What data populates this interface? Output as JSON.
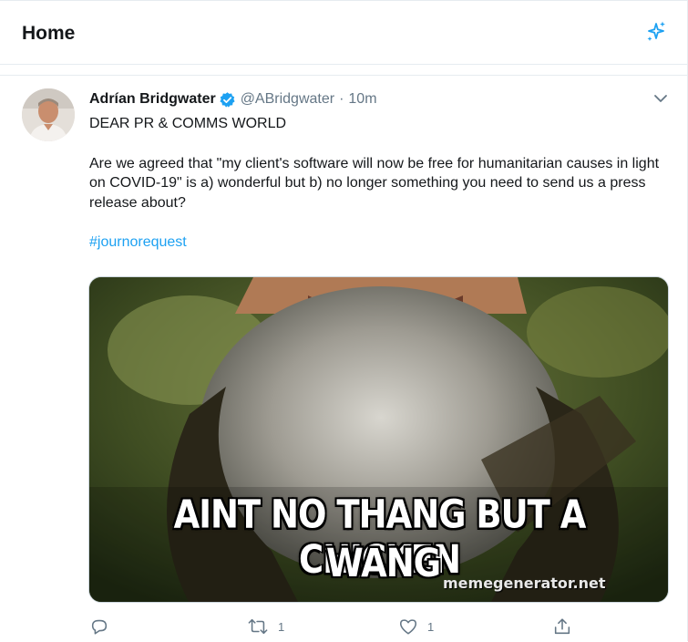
{
  "header": {
    "title": "Home",
    "sparkle_icon": "sparkle-icon",
    "accent": "#1da1f2"
  },
  "tweet": {
    "display_name": "Adrían Bridgwater",
    "verified_icon": "verified-badge-icon",
    "handle": "@ABridgwater",
    "separator": "·",
    "time": "10m",
    "more_icon": "chevron-down-icon",
    "text_line1": "DEAR PR & COMMS WORLD",
    "text_para2": "Are we agreed that \"my client's software will now be free for humanitarian causes in light on COVID-19\" is a) wonderful but b) no longer something you need to send us a press release about?",
    "hashtag": "#journorequest",
    "media": {
      "caption_line1": "AINT NO THANG BUT A CHICKEN",
      "caption_line2": "WANG",
      "watermark": "memegenerator.net"
    },
    "actions": {
      "reply_icon": "reply-icon",
      "reply_count": "",
      "retweet_icon": "retweet-icon",
      "retweet_count": "1",
      "like_icon": "heart-icon",
      "like_count": "1",
      "share_icon": "share-icon"
    }
  },
  "colors": {
    "text_primary": "#14171a",
    "text_secondary": "#657786",
    "border": "#e6ecf0",
    "link": "#1da1f2"
  }
}
